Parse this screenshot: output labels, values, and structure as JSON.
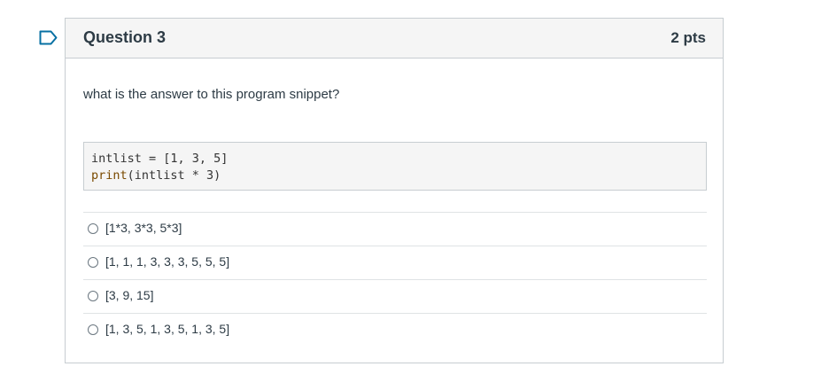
{
  "question": {
    "title": "Question 3",
    "points": "2 pts",
    "text": "what is the answer to this program snippet?",
    "code": {
      "line1": "intlist = [1, 3, 5]",
      "line2_keyword": "print",
      "line2_rest": "(intlist * 3)"
    },
    "answers": [
      {
        "label": "[1*3, 3*3, 5*3]"
      },
      {
        "label": "[1, 1, 1, 3, 3, 3, 5, 5, 5]"
      },
      {
        "label": "[3, 9, 15]"
      },
      {
        "label": "[1, 3, 5, 1, 3, 5, 1, 3, 5]"
      }
    ]
  },
  "colors": {
    "accent_flag": "#0770a3",
    "header_bg": "#f5f5f5",
    "border": "#c7cdd1"
  },
  "icons": {
    "flag": "flag-question-icon"
  }
}
